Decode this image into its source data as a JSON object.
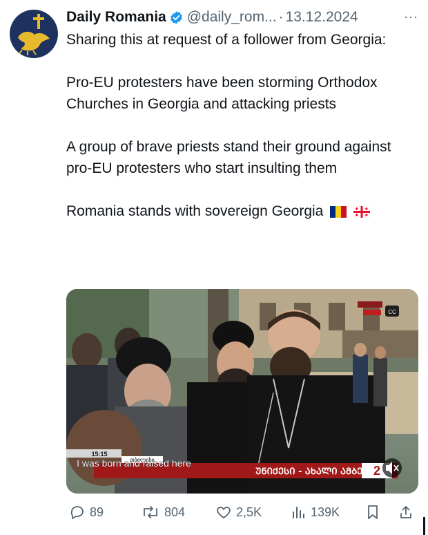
{
  "author": {
    "name": "Daily Romania",
    "handle": "@daily_rom...",
    "separator": "·",
    "date": "13.12.2024"
  },
  "menu": {
    "more_label": "···"
  },
  "tweet": {
    "paragraphs": [
      "Sharing this at request of a follower from Georgia:",
      "Pro-EU protesters have been storming Orthodox Churches in Georgia and attacking priests",
      "A group of brave priests stand their ground against pro-EU protesters who start insulting them",
      "Romania stands with sovereign Georgia"
    ]
  },
  "media": {
    "timestamp": "15:15",
    "location_tag": "თბილისი",
    "subtitle": "I was born and raised here",
    "ticker": "ᲣᲜᲘᲥᲔᲡᲘ - ᲐᲮᲐᲚᲘ ᲐᲛᲑᲔᲑᲘ",
    "channel_logo": "2",
    "cc_label": "CC",
    "mute_icon": "speaker-muted-icon"
  },
  "stats": {
    "replies": "89",
    "reposts": "804",
    "likes": "2,5K",
    "views": "139K"
  },
  "colors": {
    "text": "#0f1419",
    "muted": "#536471",
    "verified": "#1d9bf0",
    "avatar_bg": "#1e3260",
    "avatar_emblem": "#e8b92c"
  }
}
